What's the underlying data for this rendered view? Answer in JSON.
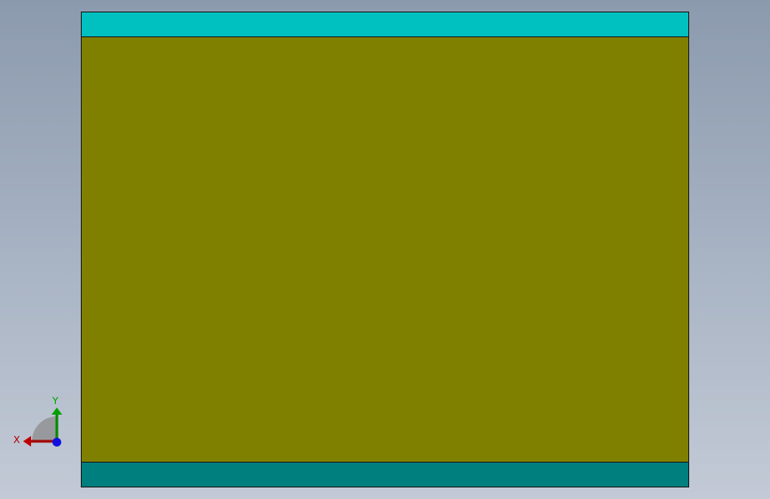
{
  "viewport": {
    "background_top": "#8c9aae",
    "background_bottom": "#c3cad6"
  },
  "model": {
    "faces": [
      {
        "name": "top-face",
        "color": "#00c0c0"
      },
      {
        "name": "middle-face",
        "color": "#808000"
      },
      {
        "name": "bottom-face",
        "color": "#007f7f"
      }
    ],
    "edge_color": "#1a1a1a"
  },
  "triad": {
    "x_label": "X",
    "y_label": "Y",
    "x_color": "#b00000",
    "y_color": "#00a000",
    "z_color": "#0000e0",
    "icon": "coordinate-triad-icon"
  }
}
